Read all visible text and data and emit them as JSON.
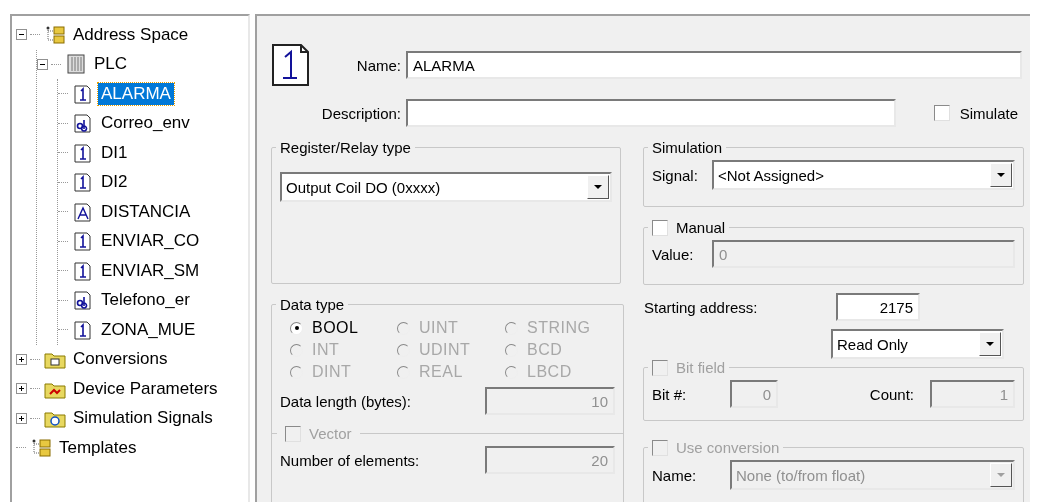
{
  "tree": [
    {
      "label": "Address Space",
      "kind": "folder-tree",
      "expanded": true,
      "selected": false,
      "children": [
        {
          "label": "PLC",
          "kind": "device",
          "expanded": true,
          "selected": false,
          "children": [
            {
              "label": "ALARMA",
              "kind": "bit",
              "selected": true
            },
            {
              "label": "Correo_env",
              "kind": "text",
              "selected": false
            },
            {
              "label": "DI1",
              "kind": "bit",
              "selected": false
            },
            {
              "label": "DI2",
              "kind": "bit",
              "selected": false
            },
            {
              "label": "DISTANCIA",
              "kind": "analog",
              "selected": false
            },
            {
              "label": "ENVIAR_CO",
              "kind": "bit",
              "selected": false
            },
            {
              "label": "ENVIAR_SM",
              "kind": "bit",
              "selected": false
            },
            {
              "label": "Telefono_er",
              "kind": "text",
              "selected": false
            },
            {
              "label": "ZONA_MUE",
              "kind": "bit",
              "selected": false
            }
          ]
        }
      ]
    },
    {
      "label": "Conversions",
      "kind": "conversion-folder",
      "expanded": false,
      "selected": false
    },
    {
      "label": "Device Parameters",
      "kind": "parameter-folder",
      "expanded": false,
      "selected": false
    },
    {
      "label": "Simulation Signals",
      "kind": "signal-folder",
      "expanded": false,
      "selected": false
    },
    {
      "label": "Templates",
      "kind": "folder-tree",
      "selected": false
    }
  ],
  "form": {
    "name": {
      "label": "Name:",
      "value": "ALARMA"
    },
    "description": {
      "label": "Description:"
    },
    "simulate": {
      "label": "Simulate",
      "checked": false,
      "disabled": false
    },
    "register_type": {
      "title": "Register/Relay type",
      "value": "Output Coil DO (0xxxx)",
      "disabled": false
    },
    "data_type": {
      "title": "Data type",
      "options": [
        {
          "label": "BOOL",
          "selected": true,
          "disabled": false
        },
        {
          "label": "UINT",
          "selected": false,
          "disabled": true
        },
        {
          "label": "STRING",
          "selected": false,
          "disabled": true
        },
        {
          "label": "INT",
          "selected": false,
          "disabled": true
        },
        {
          "label": "UDINT",
          "selected": false,
          "disabled": true
        },
        {
          "label": "BCD",
          "selected": false,
          "disabled": true
        },
        {
          "label": "DINT",
          "selected": false,
          "disabled": true
        },
        {
          "label": "REAL",
          "selected": false,
          "disabled": true
        },
        {
          "label": "LBCD",
          "selected": false,
          "disabled": true
        }
      ],
      "length": {
        "label": "Data length (bytes):",
        "value": "10",
        "disabled": true
      },
      "vector": {
        "label": "Vector",
        "checked": false,
        "disabled": true
      },
      "elements": {
        "label": "Number of elements:",
        "value": "20",
        "disabled": true
      }
    },
    "simulation": {
      "title": "Simulation",
      "signal": {
        "label": "Signal:",
        "value": "<Not Assigned>",
        "disabled": false
      }
    },
    "manual": {
      "label": "Manual",
      "checked": false,
      "disabled": false,
      "value": {
        "label": "Value:",
        "value": "0",
        "disabled": true
      }
    },
    "starting_address": {
      "label": "Starting address:",
      "value": "2175",
      "disabled": false
    },
    "access": {
      "value": "Read Only",
      "disabled": false
    },
    "bit_field": {
      "label": "Bit field",
      "checked": false,
      "disabled": true,
      "bit": {
        "label": "Bit #:",
        "value": "0",
        "disabled": true
      },
      "count": {
        "label": "Count:",
        "value": "1",
        "disabled": true
      }
    },
    "conversion": {
      "label": "Use conversion",
      "checked": false,
      "disabled": true,
      "name": {
        "label": "Name:",
        "value": "None (to/from float)",
        "disabled": true
      }
    }
  }
}
